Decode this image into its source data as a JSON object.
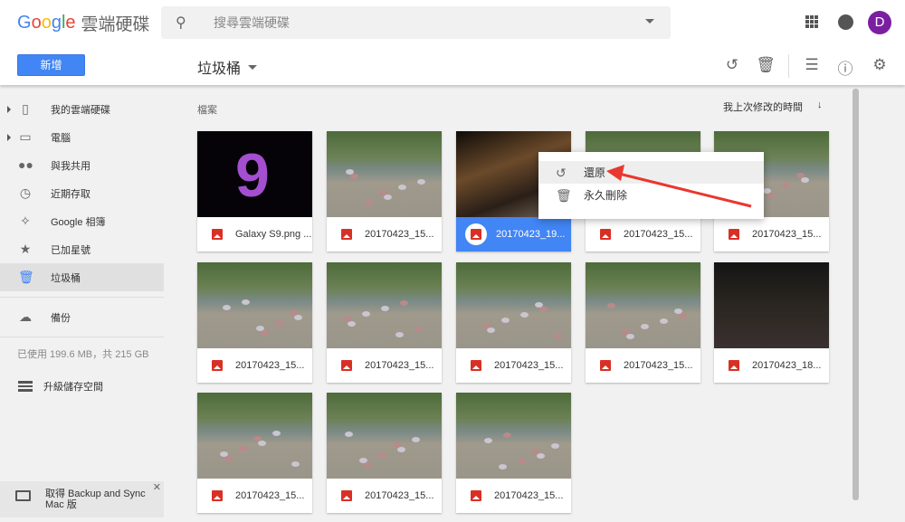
{
  "header": {
    "logo": "Google",
    "product": "雲端硬碟",
    "search_placeholder": "搜尋雲端硬碟",
    "avatar_letter": "D"
  },
  "toolbar": {
    "new_label": "新增",
    "breadcrumb": "垃圾桶"
  },
  "sidebar": {
    "items": [
      {
        "label": "我的雲端硬碟",
        "icon": "drive-icon"
      },
      {
        "label": "電腦",
        "icon": "computer-icon"
      },
      {
        "label": "與我共用",
        "icon": "people-icon"
      },
      {
        "label": "近期存取",
        "icon": "clock-icon"
      },
      {
        "label": "Google 相簿",
        "icon": "photos-icon"
      },
      {
        "label": "已加星號",
        "icon": "star-icon"
      },
      {
        "label": "垃圾桶",
        "icon": "trash-icon"
      },
      {
        "label": "備份",
        "icon": "cloud-icon"
      }
    ],
    "quota": "已使用 199.6 MB，共 215 GB",
    "upgrade": "升級儲存空間",
    "promo": "取得 Backup and Sync Mac 版"
  },
  "main": {
    "section_label": "檔案",
    "sort_label": "我上次修改的時間",
    "files": [
      "Galaxy S9.png ...",
      "20170423_15...",
      "20170423_19...",
      "20170423_15...",
      "20170423_15...",
      "20170423_15...",
      "20170423_15...",
      "20170423_15...",
      "20170423_15...",
      "20170423_18...",
      "20170423_15...",
      "20170423_15...",
      "20170423_15..."
    ]
  },
  "context_menu": {
    "items": [
      "還原",
      "永久刪除"
    ]
  },
  "colors": {
    "accent": "#4285f4",
    "arrow": "#e8382f"
  }
}
